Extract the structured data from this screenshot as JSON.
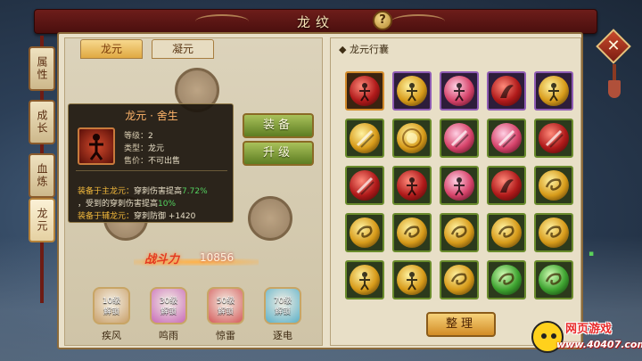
{
  "header": {
    "title": "龙纹",
    "help_label": "?",
    "close_label": "✕"
  },
  "side_tabs": [
    {
      "label": "属性",
      "active": false
    },
    {
      "label": "成长",
      "active": false
    },
    {
      "label": "血炼",
      "active": false
    },
    {
      "label": "龙元",
      "active": true
    }
  ],
  "tabs": [
    {
      "label": "龙元",
      "active": true
    },
    {
      "label": "凝元",
      "active": false
    }
  ],
  "tooltip": {
    "title": "龙元 · 舍生",
    "level_key": "等级：",
    "level": "2",
    "type_key": "类型：",
    "type": "龙元",
    "price_key": "售价：",
    "price": "不可出售",
    "main_label": "装备于主龙元：",
    "main_text": "穿刺伤害提高",
    "main_value": "7.72%",
    "main_text2": "受到的穿刺伤害提高",
    "main_value2": "10%",
    "aux_label": "装备于辅龙元：",
    "aux_text": "穿刺防御",
    "aux_value": "+1420"
  },
  "buttons": {
    "equip": "装备",
    "upgrade": "升级",
    "sort": "整理"
  },
  "power": {
    "label": "战斗力",
    "value": "10856"
  },
  "locks": [
    {
      "level_text": "10级",
      "unlock_text": "解锁",
      "name": "疾风",
      "color": "#c9a06a"
    },
    {
      "level_text": "30级",
      "unlock_text": "解锁",
      "name": "鸣雨",
      "color": "#c86ab8"
    },
    {
      "level_text": "50级",
      "unlock_text": "解锁",
      "name": "惊雷",
      "color": "#d45a5a"
    },
    {
      "level_text": "70级",
      "unlock_text": "解锁",
      "name": "逐电",
      "color": "#5ab0c8"
    }
  ],
  "bag": {
    "title": "龙元行囊",
    "rows": [
      [
        {
          "orb": "red",
          "frame": "orange",
          "icon": "figure-icon"
        },
        {
          "orb": "gold",
          "frame": "purple",
          "icon": "figure-icon"
        },
        {
          "orb": "pink",
          "frame": "purple",
          "icon": "figure-icon"
        },
        {
          "orb": "red",
          "frame": "purple",
          "icon": "claw-icon"
        },
        {
          "orb": "gold",
          "frame": "purple",
          "icon": "figure-icon"
        }
      ],
      [
        {
          "orb": "gold",
          "frame": "green",
          "icon": "slash-icon"
        },
        {
          "orb": "gold",
          "frame": "green",
          "icon": "burst-icon"
        },
        {
          "orb": "pink",
          "frame": "green",
          "icon": "slash-icon"
        },
        {
          "orb": "pink",
          "frame": "green",
          "icon": "slash-icon"
        },
        {
          "orb": "red",
          "frame": "green",
          "icon": "slash-icon"
        }
      ],
      [
        {
          "orb": "red",
          "frame": "green",
          "icon": "slash-icon"
        },
        {
          "orb": "red",
          "frame": "green",
          "icon": "figure-icon"
        },
        {
          "orb": "pink",
          "frame": "green",
          "icon": "figure-icon"
        },
        {
          "orb": "red",
          "frame": "green",
          "icon": "claw-icon"
        },
        {
          "orb": "gold",
          "frame": "green",
          "icon": "swirl-icon"
        }
      ],
      [
        {
          "orb": "gold",
          "frame": "green",
          "icon": "swirl-icon"
        },
        {
          "orb": "gold",
          "frame": "green",
          "icon": "swirl-icon"
        },
        {
          "orb": "gold",
          "frame": "green",
          "icon": "swirl-icon"
        },
        {
          "orb": "gold",
          "frame": "green",
          "icon": "swirl-icon"
        },
        {
          "orb": "gold",
          "frame": "green",
          "icon": "swirl-icon"
        }
      ],
      [
        {
          "orb": "gold",
          "frame": "green",
          "icon": "figure-icon"
        },
        {
          "orb": "gold",
          "frame": "green",
          "icon": "figure-icon"
        },
        {
          "orb": "gold",
          "frame": "green",
          "icon": "swirl-icon"
        },
        {
          "orb": "green",
          "frame": "green",
          "icon": "swirl-icon"
        },
        {
          "orb": "green",
          "frame": "green",
          "icon": "swirl-icon"
        }
      ]
    ]
  },
  "watermark": {
    "top": "网页游戏",
    "bottom": "www.40407.com"
  }
}
